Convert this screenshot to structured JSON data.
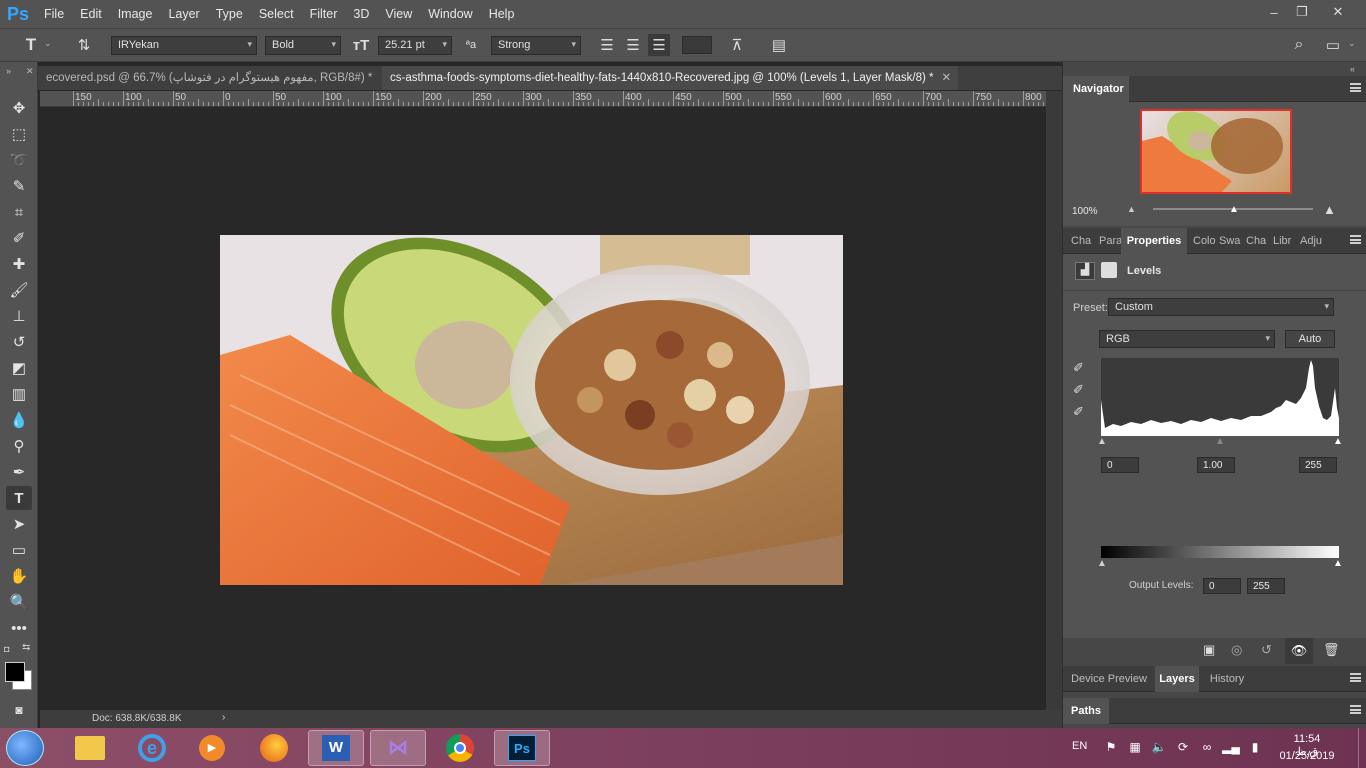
{
  "app": {
    "logo": "Ps"
  },
  "menu": [
    "File",
    "Edit",
    "Image",
    "Layer",
    "Type",
    "Select",
    "Filter",
    "3D",
    "View",
    "Window",
    "Help"
  ],
  "window_controls": {
    "minimize": "–",
    "restore": "❐",
    "close": "✕"
  },
  "options_bar": {
    "font_family": "IRYekan",
    "font_style": "Bold",
    "font_size": "25.21 pt",
    "anti_alias_label": "ªa",
    "anti_alias": "Strong"
  },
  "tabs": [
    {
      "label": "ecovered.psd @ 66.7% (مفهوم هیستوگرام در فتوشاپ, RGB/8#) *",
      "active": false
    },
    {
      "label": "cs-asthma-foods-symptoms-diet-healthy-fats-1440x810-Recovered.jpg @ 100% (Levels 1, Layer Mask/8) *",
      "active": true
    }
  ],
  "ruler": [
    "150",
    "100",
    "50",
    "0",
    "50",
    "100",
    "150",
    "200",
    "250",
    "300",
    "350",
    "400",
    "450",
    "500",
    "550",
    "600",
    "650",
    "700",
    "750",
    "800"
  ],
  "status": {
    "doc": "Doc: 638.8K/638.8K"
  },
  "navigator": {
    "title": "Navigator",
    "zoom": "100%"
  },
  "properties": {
    "tabs": [
      "Cha",
      "Para",
      "Properties",
      "Colo",
      "Swa",
      "Cha",
      "Libr",
      "Adju"
    ],
    "adjustment": "Levels",
    "preset_label": "Preset:",
    "preset": "Custom",
    "channel": "RGB",
    "auto_button": "Auto",
    "input_black": "0",
    "input_gamma": "1.00",
    "input_white": "255",
    "output_label": "Output Levels:",
    "output_black": "0",
    "output_white": "255"
  },
  "bottom_tabs": [
    "Device Preview",
    "Layers",
    "History"
  ],
  "paths_tab": "Paths",
  "taskbar": {
    "lang": "EN",
    "time": "11:54 ق.ظ",
    "date": "01/25/2019",
    "apps": [
      "explorer-icon",
      "ie-icon",
      "media-icon",
      "firefox-icon",
      "word-icon",
      "vs-icon",
      "chrome-icon",
      "photoshop-icon"
    ]
  },
  "colors": {
    "accent": "#31a8ff",
    "panel": "#535353",
    "canvas": "#282828"
  }
}
